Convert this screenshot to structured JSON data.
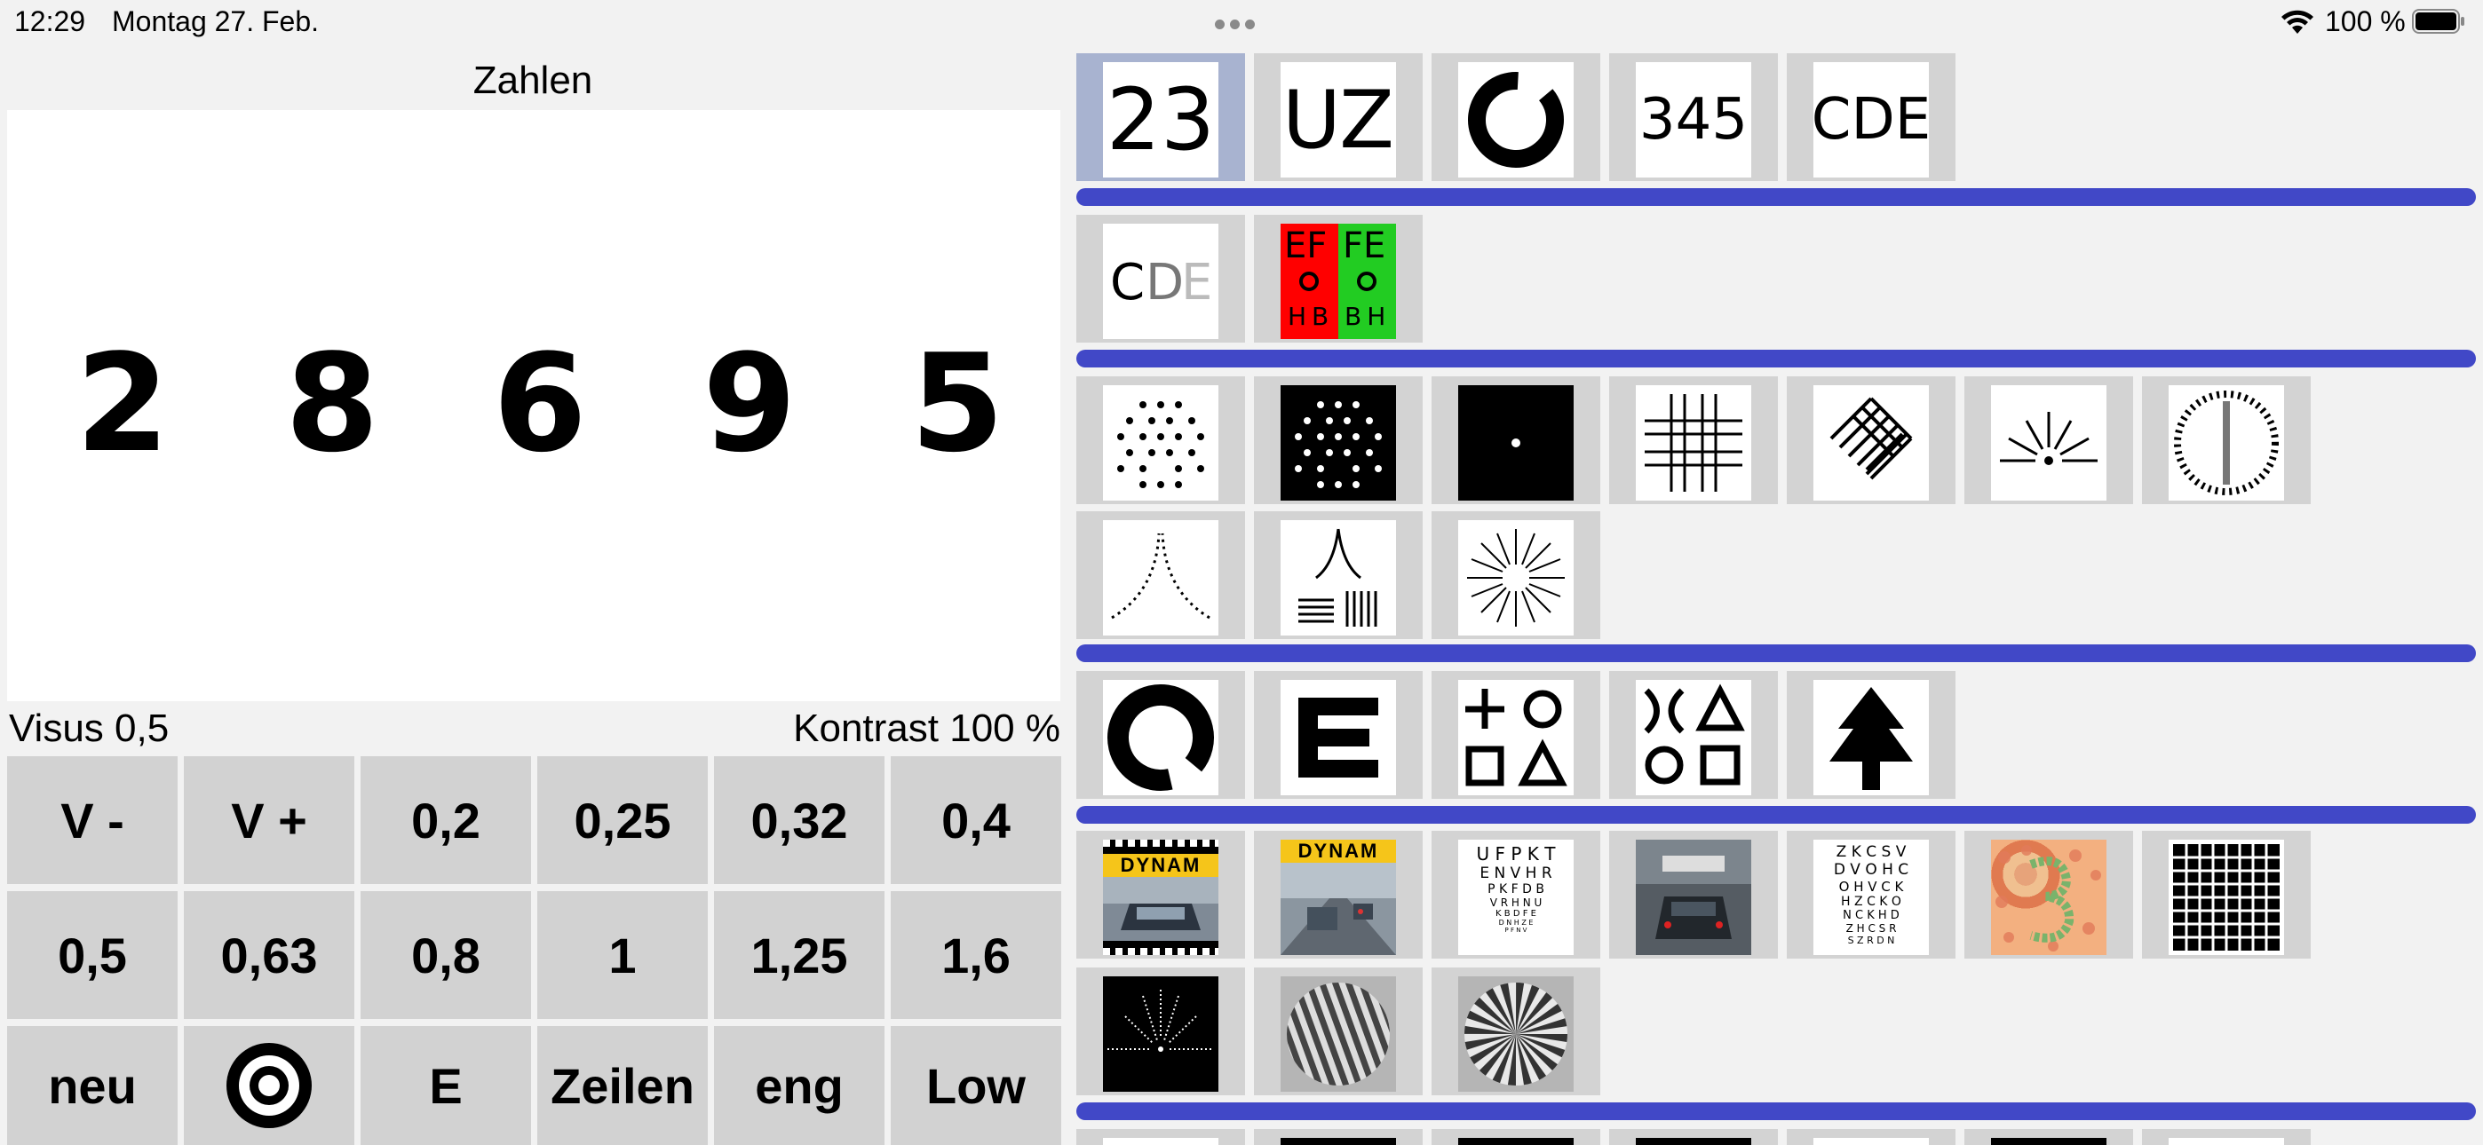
{
  "status_bar": {
    "time": "12:29",
    "date": "Montag 27. Feb.",
    "battery": "100 %"
  },
  "left_panel": {
    "title": "Zahlen",
    "digits": [
      "2",
      "8",
      "6",
      "9",
      "5"
    ],
    "visus_label": "Visus  0,5",
    "contrast_label": "Kontrast  100 %",
    "buttons": [
      [
        "V -",
        "V +",
        "0,2",
        "0,25",
        "0,32",
        "0,4"
      ],
      [
        "0,5",
        "0,63",
        "0,8",
        "1",
        "1,25",
        "1,6"
      ],
      [
        "neu",
        "",
        "E",
        "Zeilen",
        "eng",
        "Low"
      ]
    ]
  },
  "right_panel": {
    "thumbs": {
      "numbers": "23",
      "letters": "UZ",
      "numbers_small": "345",
      "letters_cde": "CDE",
      "red_green_left": "EF",
      "red_green_right": "FE",
      "red_green_left_bottom": "HB",
      "red_green_right_bottom": "BH",
      "dynam": "DYNAM",
      "chart1_lines": [
        "U F P K T",
        "E N V H R",
        "P K F D B",
        "V R H N U",
        "K B D F E",
        "D N H Z E",
        "P F N V"
      ],
      "chart2_lines": [
        "Z K C S V",
        "D V O H C",
        "O H V C K",
        "H Z C K O",
        "N C K H D",
        "Z H C S R",
        "S Z R D N"
      ]
    },
    "colors": {
      "divider": "#4148c7",
      "selected": "#a8b3d0",
      "red": "#ff0000",
      "green": "#22cc22",
      "yellow": "#f5c51a"
    }
  }
}
